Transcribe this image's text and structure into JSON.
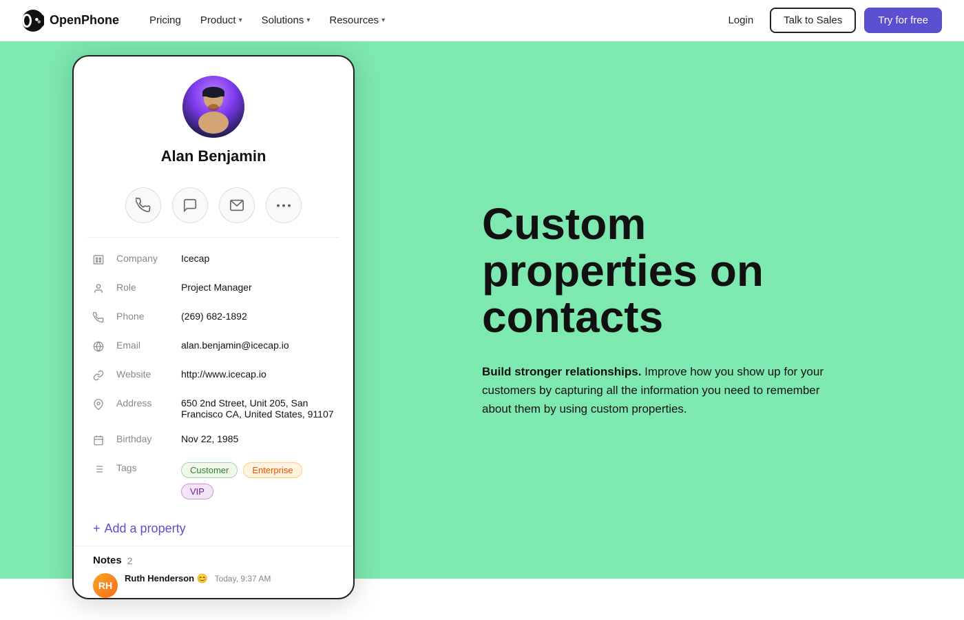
{
  "nav": {
    "logo_text": "OpenPhone",
    "links": [
      {
        "label": "Pricing",
        "has_dropdown": false
      },
      {
        "label": "Product",
        "has_dropdown": true
      },
      {
        "label": "Solutions",
        "has_dropdown": true
      },
      {
        "label": "Resources",
        "has_dropdown": true
      }
    ],
    "login_label": "Login",
    "talk_sales_label": "Talk to Sales",
    "try_free_label": "Try for free"
  },
  "contact": {
    "name": "Alan Benjamin",
    "company": "Icecap",
    "role": "Project Manager",
    "phone": "(269) 682-1892",
    "email": "alan.benjamin@icecap.io",
    "website": "http://www.icecap.io",
    "address": "650 2nd Street, Unit 205, San Francisco CA, United States, 91107",
    "birthday": "Nov 22, 1985",
    "tags": [
      "Customer",
      "Enterprise",
      "VIP"
    ]
  },
  "actions": {
    "call_icon": "☎",
    "message_icon": "💬",
    "email_icon": "✉",
    "more_icon": "⋯"
  },
  "properties": {
    "company_label": "Company",
    "role_label": "Role",
    "phone_label": "Phone",
    "email_label": "Email",
    "website_label": "Website",
    "address_label": "Address",
    "birthday_label": "Birthday",
    "tags_label": "Tags"
  },
  "add_property": {
    "label": "Add a property"
  },
  "notes": {
    "title": "Notes",
    "count": "2",
    "first_author": "Ruth Henderson",
    "first_emoji": "😊",
    "first_time": "Today, 9:37 AM"
  },
  "hero": {
    "heading": "Custom properties on contacts",
    "body_bold": "Build stronger relationships.",
    "body_text": " Improve how you show up for your customers by capturing all the information you need to remember about them by using custom properties."
  }
}
